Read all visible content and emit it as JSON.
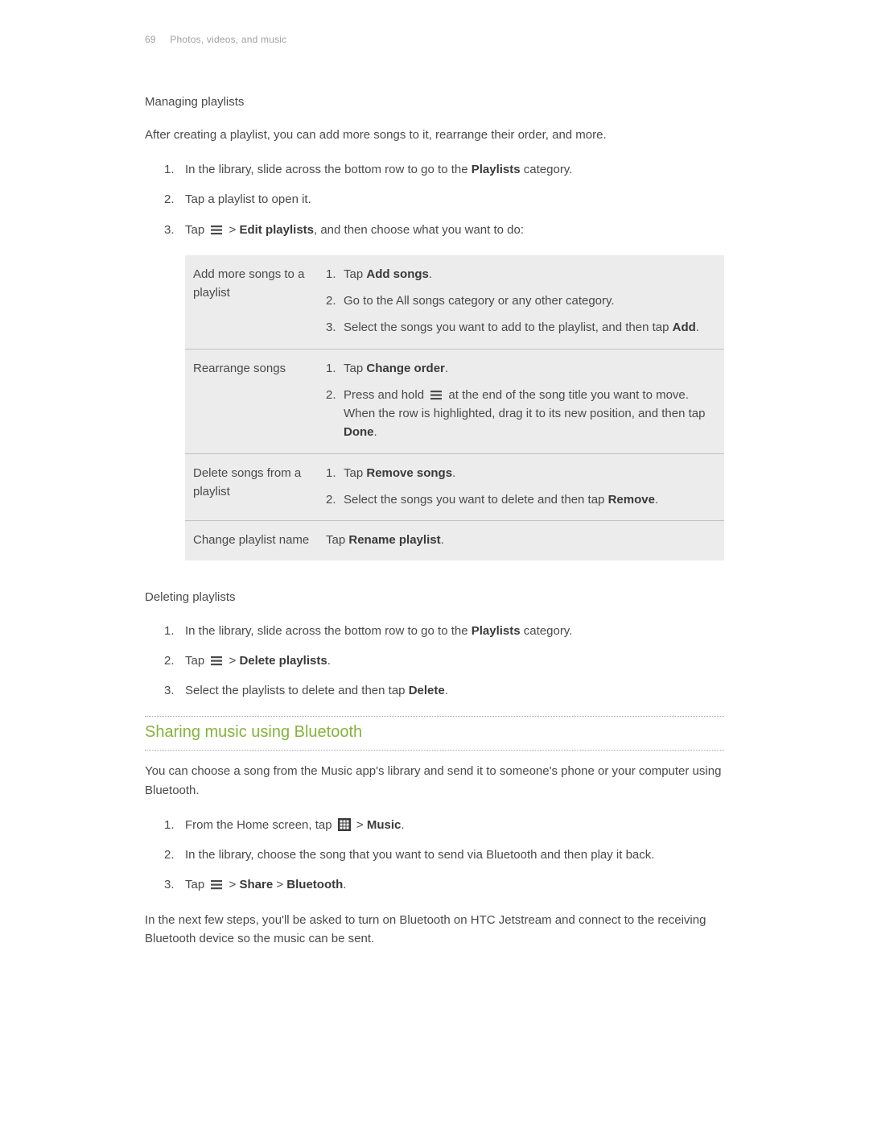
{
  "header": {
    "page": "69",
    "chapter": "Photos, videos, and music"
  },
  "section1": {
    "title": "Managing playlists",
    "intro": "After creating a playlist, you can add more songs to it, rearrange their order, and more.",
    "steps": {
      "s1_a": "In the library, slide across the bottom row to go to the ",
      "s1_b": "Playlists",
      "s1_c": " category.",
      "s2": "Tap a playlist to open it.",
      "s3_a": "Tap ",
      "s3_b": " > ",
      "s3_c": "Edit playlists",
      "s3_d": ", and then choose what you want to do:"
    },
    "table": {
      "r1": {
        "label": "Add more songs to a playlist",
        "i1_a": "Tap ",
        "i1_b": "Add songs",
        "i1_c": ".",
        "i2": "Go to the All songs category or any other category.",
        "i3_a": "Select the songs you want to add to the playlist, and then tap ",
        "i3_b": "Add",
        "i3_c": "."
      },
      "r2": {
        "label": "Rearrange songs",
        "i1_a": "Tap ",
        "i1_b": "Change order",
        "i1_c": ".",
        "i2_a": "Press and hold ",
        "i2_b": " at the end of the song title you want to move. When the row is highlighted, drag it to its new position, and then tap ",
        "i2_c": "Done",
        "i2_d": "."
      },
      "r3": {
        "label": "Delete songs from a playlist",
        "i1_a": "Tap ",
        "i1_b": "Remove songs",
        "i1_c": ".",
        "i2_a": "Select the songs you want to delete and then tap ",
        "i2_b": "Remove",
        "i2_c": "."
      },
      "r4": {
        "label": "Change playlist name",
        "txt_a": "Tap ",
        "txt_b": "Rename playlist",
        "txt_c": "."
      }
    }
  },
  "section2": {
    "title": "Deleting playlists",
    "steps": {
      "s1_a": "In the library, slide across the bottom row to go to the ",
      "s1_b": "Playlists",
      "s1_c": " category.",
      "s2_a": "Tap ",
      "s2_b": " > ",
      "s2_c": "Delete playlists",
      "s2_d": ".",
      "s3_a": "Select the playlists to delete and then tap ",
      "s3_b": "Delete",
      "s3_c": "."
    }
  },
  "section3": {
    "title": "Sharing music using Bluetooth",
    "intro": "You can choose a song from the Music app's library and send it to someone's phone or your computer using Bluetooth.",
    "steps": {
      "s1_a": "From the Home screen, tap ",
      "s1_b": " > ",
      "s1_c": "Music",
      "s1_d": ".",
      "s2": "In the library, choose the song that you want to send via Bluetooth and then play it back.",
      "s3_a": "Tap ",
      "s3_b": " > ",
      "s3_c": "Share",
      "s3_d": " > ",
      "s3_e": "Bluetooth",
      "s3_f": "."
    },
    "outro": "In the next few steps, you'll be asked to turn on Bluetooth on HTC Jetstream and connect to the receiving Bluetooth device so the music can be sent."
  }
}
